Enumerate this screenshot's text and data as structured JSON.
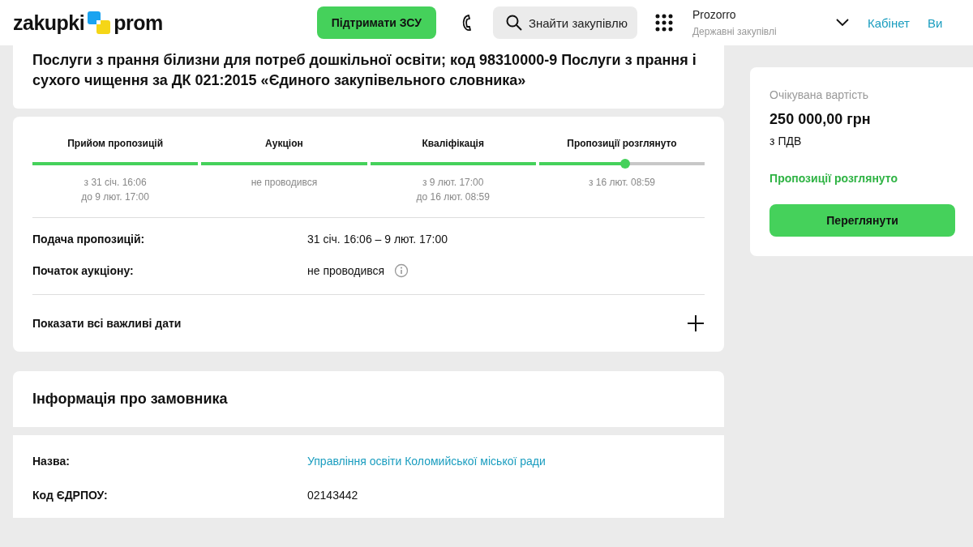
{
  "header": {
    "logo": {
      "left": "zakupki",
      "right": "prom"
    },
    "support_button": "Підтримати ЗСУ",
    "search": {
      "placeholder": "Знайти закупівлю"
    },
    "platform": {
      "title": "Prozorro",
      "subtitle": "Державні закупівлі"
    },
    "links": [
      "Кабінет",
      "Ви"
    ]
  },
  "tender": {
    "title": "Послуги з прання білизни для потреб дошкільної освіти; код 98310000-9 Послуги з прання і сухого чищення за ДК 021:2015 «Єдиного закупівельного словника»"
  },
  "timeline": {
    "stages": [
      {
        "label": "Прийом пропозицій",
        "level": 1,
        "dates": [
          "з 31 січ. 16:06",
          "до 9 лют. 17:00"
        ]
      },
      {
        "label": "Аукціон",
        "level": 1,
        "dates": [
          "не проводився"
        ]
      },
      {
        "label": "Кваліфікація",
        "level": 1,
        "dates": [
          "з 9 лют. 17:00",
          "до 16 лют. 08:59"
        ]
      },
      {
        "label": "Пропозиції розглянуто",
        "level": 0.52,
        "dates": [
          "з 16 лют. 08:59"
        ]
      }
    ],
    "rows": [
      {
        "label": "Подача пропозицій:",
        "value": "31 січ. 16:06 – 9 лют. 17:00",
        "info": false
      },
      {
        "label": "Початок аукціону:",
        "value": "не проводився",
        "info": true
      }
    ],
    "expand": {
      "label": "Показати всі важливі дати",
      "expanded": false
    }
  },
  "customer": {
    "title": "Інформація про замовника",
    "rows": [
      {
        "label": "Назва:",
        "value": "Управління освіти Коломийської міської ради",
        "kind": "link"
      },
      {
        "label": "Код ЄДРПОУ:",
        "value": "02143442",
        "kind": "text"
      }
    ]
  },
  "summary": {
    "label": "Очікувана вартість",
    "amount": "250 000,00 грн",
    "vat": "з ПДВ",
    "status": "Пропозиції розглянуто",
    "button": "Переглянути"
  }
}
